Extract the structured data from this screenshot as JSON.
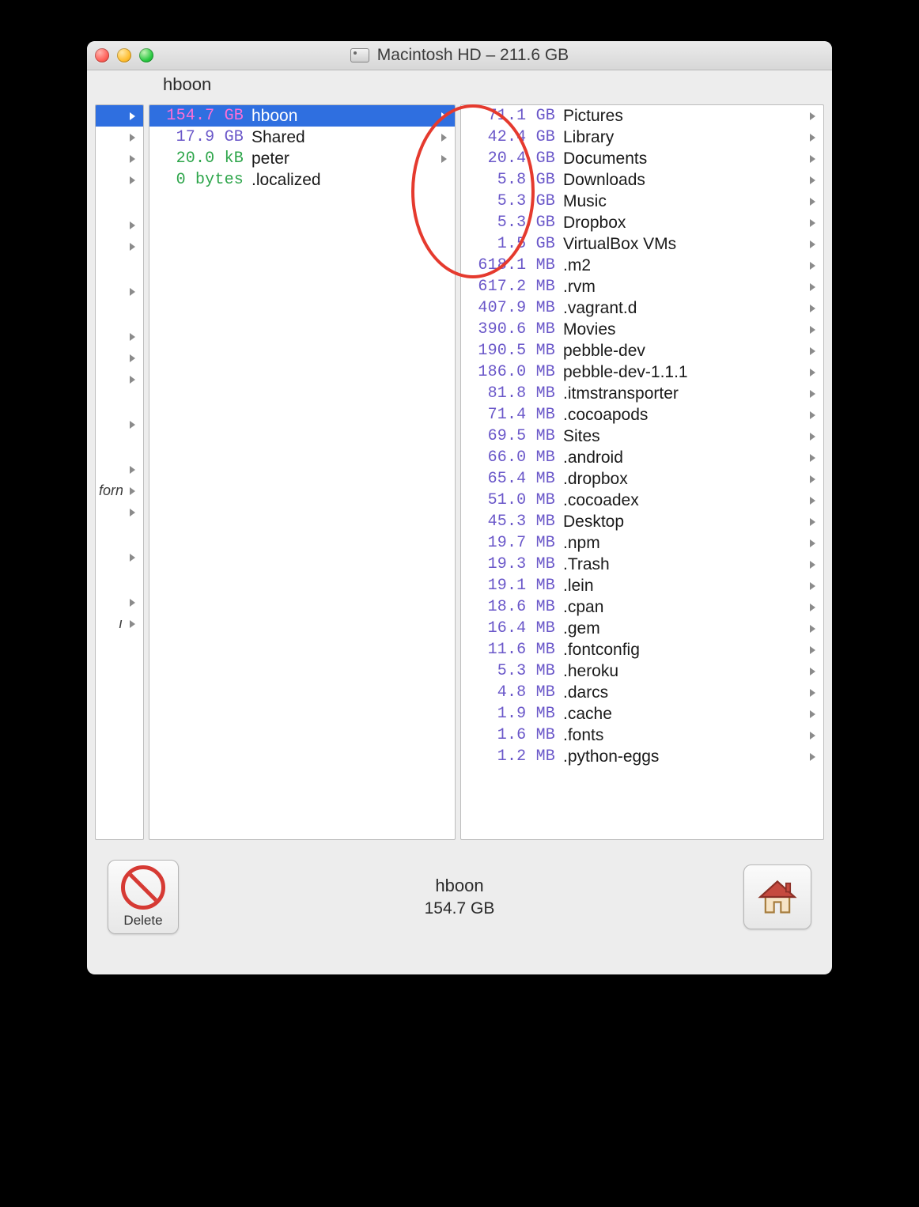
{
  "window": {
    "title": "Macintosh HD – 211.6 GB"
  },
  "breadcrumb": "hboon",
  "annotation": {
    "type": "ellipse",
    "color": "#e53a2e",
    "note": "hand-drawn circle around top GB sizes in right column"
  },
  "col0": [
    {
      "text": "",
      "selected": true
    },
    {
      "text": ""
    },
    {
      "text": ""
    },
    {
      "text": ""
    },
    {
      "text": ""
    },
    {
      "text": ""
    },
    {
      "text": ""
    },
    {
      "text": ""
    },
    {
      "text": ""
    },
    {
      "text": ""
    },
    {
      "text": ""
    },
    {
      "text": ""
    },
    {
      "text": "forn"
    },
    {
      "text": ""
    },
    {
      "text": ""
    },
    {
      "text": ""
    },
    {
      "text": "ı"
    }
  ],
  "col1": [
    {
      "size": "154.7 GB",
      "name": "hboon",
      "selected": true,
      "arrow": true
    },
    {
      "size": "17.9 GB",
      "name": "Shared",
      "arrow": true
    },
    {
      "size": "20.0 kB",
      "name": "peter",
      "arrow": true,
      "kb": true
    },
    {
      "size": "0 bytes",
      "name": ".localized",
      "arrow": false,
      "zero": true
    }
  ],
  "col2": [
    {
      "size": "71.1 GB",
      "name": "Pictures"
    },
    {
      "size": "42.4 GB",
      "name": "Library"
    },
    {
      "size": "20.4 GB",
      "name": "Documents"
    },
    {
      "size": "5.8 GB",
      "name": "Downloads"
    },
    {
      "size": "5.3 GB",
      "name": "Music"
    },
    {
      "size": "5.3 GB",
      "name": "Dropbox"
    },
    {
      "size": "1.5 GB",
      "name": "VirtualBox VMs"
    },
    {
      "size": "618.1 MB",
      "name": ".m2"
    },
    {
      "size": "617.2 MB",
      "name": ".rvm"
    },
    {
      "size": "407.9 MB",
      "name": ".vagrant.d"
    },
    {
      "size": "390.6 MB",
      "name": "Movies"
    },
    {
      "size": "190.5 MB",
      "name": "pebble-dev"
    },
    {
      "size": "186.0 MB",
      "name": "pebble-dev-1.1.1"
    },
    {
      "size": "81.8 MB",
      "name": ".itmstransporter"
    },
    {
      "size": "71.4 MB",
      "name": ".cocoapods"
    },
    {
      "size": "69.5 MB",
      "name": "Sites"
    },
    {
      "size": "66.0 MB",
      "name": ".android"
    },
    {
      "size": "65.4 MB",
      "name": ".dropbox"
    },
    {
      "size": "51.0 MB",
      "name": ".cocoadex"
    },
    {
      "size": "45.3 MB",
      "name": "Desktop"
    },
    {
      "size": "19.7 MB",
      "name": ".npm"
    },
    {
      "size": "19.3 MB",
      "name": ".Trash"
    },
    {
      "size": "19.1 MB",
      "name": ".lein"
    },
    {
      "size": "18.6 MB",
      "name": ".cpan"
    },
    {
      "size": "16.4 MB",
      "name": ".gem"
    },
    {
      "size": "11.6 MB",
      "name": ".fontconfig"
    },
    {
      "size": "5.3 MB",
      "name": ".heroku"
    },
    {
      "size": "4.8 MB",
      "name": ".darcs"
    },
    {
      "size": "1.9 MB",
      "name": ".cache"
    },
    {
      "size": "1.6 MB",
      "name": ".fonts"
    },
    {
      "size": "1.2 MB",
      "name": ".python-eggs"
    }
  ],
  "footer": {
    "selected_name": "hboon",
    "selected_size": "154.7 GB",
    "delete_label": "Delete"
  }
}
